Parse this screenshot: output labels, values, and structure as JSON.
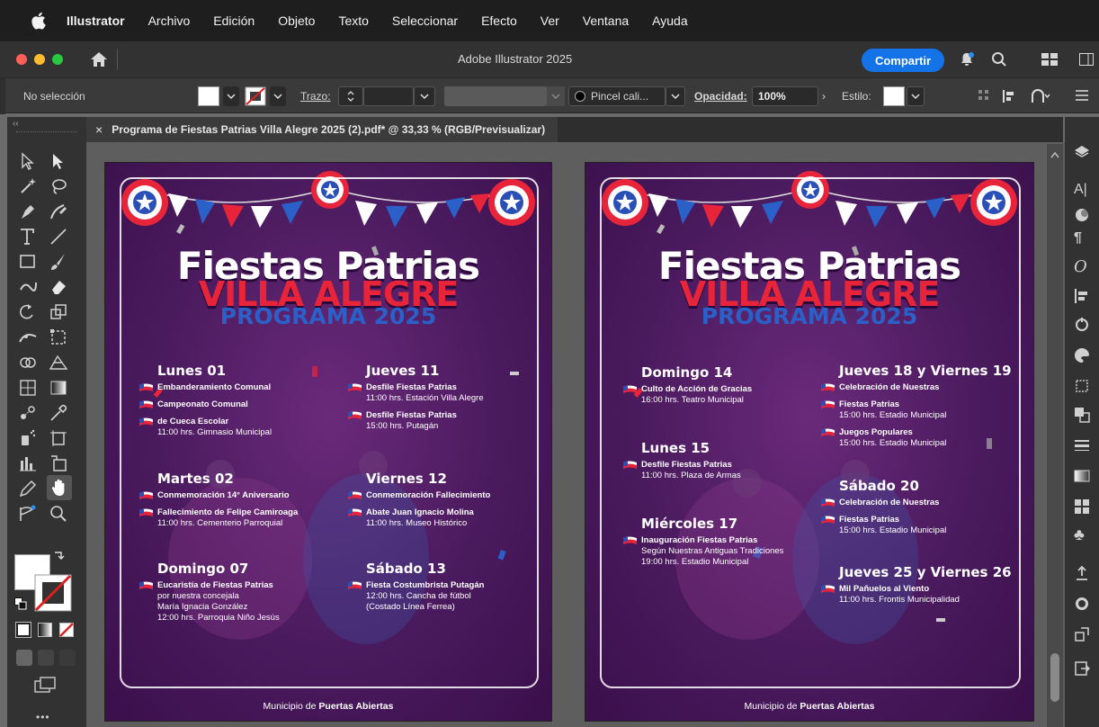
{
  "menubar": {
    "items": [
      "Illustrator",
      "Archivo",
      "Edición",
      "Objeto",
      "Texto",
      "Seleccionar",
      "Efecto",
      "Ver",
      "Ventana",
      "Ayuda"
    ]
  },
  "titlebar": {
    "title": "Adobe Illustrator 2025",
    "share_label": "Compartir"
  },
  "controlbar": {
    "selection": "No selección",
    "stroke_label": "Trazo:",
    "brush": "Pincel cali...",
    "opacity_label": "Opacidad:",
    "opacity_value": "100%",
    "style_label": "Estilo:"
  },
  "document": {
    "tab_title": "Programa de Fiestas Patrias Villa Alegre 2025 (2).pdf* @ 33,33 % (RGB/Previsualizar)",
    "close_glyph": "×"
  },
  "poster": {
    "title1": "Fiestas Patrias",
    "title2": "VILLA ALEGRE",
    "title3": "PROGRAMA 2025",
    "footer_prefix": "Municipio de ",
    "footer_bold": "Puertas Abiertas"
  },
  "page1": {
    "days": [
      {
        "label": "Lunes 01",
        "events": [
          {
            "name": "Embanderamiento Comunal",
            "details": []
          },
          {
            "name": "Campeonato Comunal",
            "details": []
          },
          {
            "name": "de Cueca Escolar",
            "details": [
              "11:00 hrs. Gimnasio Municipal"
            ]
          }
        ]
      },
      {
        "label": "Martes 02",
        "events": [
          {
            "name": "Conmemoración 14° Aniversario",
            "details": []
          },
          {
            "name": "Fallecimiento de Felipe Camiroaga",
            "details": [
              "11:00 hrs.  Cementerio Parroquial"
            ]
          }
        ]
      },
      {
        "label": "Domingo 07",
        "events": [
          {
            "name": "Eucaristía de Fiestas Patrias",
            "details": [
              "por nuestra concejala",
              "María Ignacia González",
              "12:00 hrs. Parroquia Niño Jesús"
            ]
          }
        ]
      },
      {
        "label": "Jueves 11",
        "events": [
          {
            "name": "Desfile Fiestas Patrias",
            "details": [
              "11:00 hrs.  Estación Villa Alegre"
            ]
          },
          {
            "name": "Desfile Fiestas Patrias",
            "details": [
              "15:00 hrs. Putagán"
            ]
          }
        ]
      },
      {
        "label": "Viernes 12",
        "events": [
          {
            "name": "Conmemoración Fallecimiento",
            "details": []
          },
          {
            "name": "Abate Juan Ignacio Molina",
            "details": [
              "11:00 hrs. Museo Histórico"
            ]
          }
        ]
      },
      {
        "label": "Sábado 13",
        "events": [
          {
            "name": "Fiesta Costumbrista Putagán",
            "details": [
              "12:00 hrs. Cancha de fútbol",
              "(Costado Línea Ferrea)"
            ]
          }
        ]
      }
    ]
  },
  "page2": {
    "days": [
      {
        "label": "Domingo 14",
        "events": [
          {
            "name": "Culto de Acción de Gracias",
            "details": [
              "16:00 hrs. Teatro Municipal"
            ]
          }
        ]
      },
      {
        "label": "Lunes 15",
        "events": [
          {
            "name": "Desfile Fiestas Patrias",
            "details": [
              "11:00 hrs. Plaza de Armas"
            ]
          }
        ]
      },
      {
        "label": "Miércoles 17",
        "events": [
          {
            "name": "Inauguración Fiestas Patrias",
            "details": [
              "Según Nuestras Antiguas Tradiciones",
              "19:00 hrs.  Estadio Municipal"
            ]
          }
        ]
      },
      {
        "label": "Jueves 18 y Viernes 19",
        "events": [
          {
            "name": "Celebración de Nuestras",
            "details": []
          },
          {
            "name": "Fiestas Patrias",
            "details": [
              "15:00 hrs. Estadio Municipal"
            ]
          },
          {
            "name": "Juegos Populares",
            "details": [
              "15:00 hrs. Estadio Municipal"
            ]
          }
        ]
      },
      {
        "label": "Sábado 20",
        "events": [
          {
            "name": "Celebración de Nuestras",
            "details": []
          },
          {
            "name": "Fiestas Patrias",
            "details": [
              "15:00 hrs. Estadio Municipal"
            ]
          }
        ]
      },
      {
        "label": "Jueves 25 y Viernes 26",
        "events": [
          {
            "name": "Mil Pañuelos al Viento",
            "details": [
              "11:00 hrs. Frontis Municipalidad"
            ]
          }
        ]
      }
    ]
  }
}
